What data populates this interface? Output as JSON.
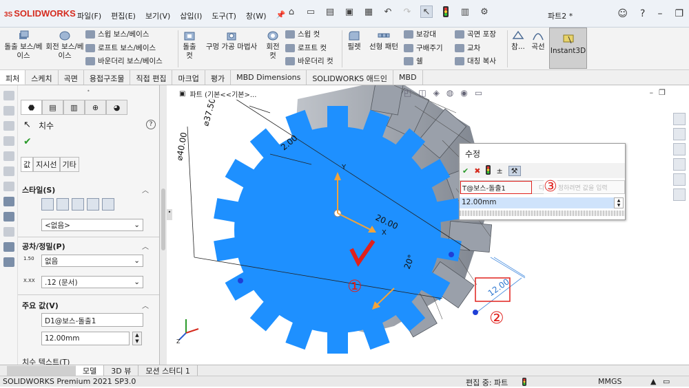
{
  "app": {
    "brand": "SOLIDWORKS",
    "part_name": "파트2 *"
  },
  "menu": [
    "파일(F)",
    "편집(E)",
    "보기(V)",
    "삽입(I)",
    "도구(T)",
    "창(W)"
  ],
  "ribbon": {
    "extrude_boss": "돌출 보스/베이스",
    "revolve_boss": "회전 보스/베이스",
    "sweep_boss": "스윕 보스/베이스",
    "loft_boss": "로프트 보스/베이스",
    "boundary_boss": "바운더리 보스/베이스",
    "extrude_cut": "돌출 컷",
    "hole_wizard": "구멍 가공 마법사",
    "revolve_cut": "회전 컷",
    "sweep_cut": "스윕 컷",
    "loft_cut": "로프트 컷",
    "boundary_cut": "바운더리 컷",
    "fillet": "필렛",
    "linear_pattern": "선형 패턴",
    "rib": "보강대",
    "draft": "구배주기",
    "shell": "쉘",
    "wrap": "곡면 포장",
    "intersect": "교차",
    "mirror": "대칭 복사",
    "reference": "참...",
    "curves": "곡선",
    "instant3d": "Instant3D"
  },
  "tabs": [
    "피처",
    "스케치",
    "곡면",
    "용접구조물",
    "직접 편집",
    "마크업",
    "평가",
    "MBD Dimensions",
    "SOLIDWORKS 애드인",
    "MBD"
  ],
  "propertymanager": {
    "title": "치수",
    "help": "?",
    "subtabs": [
      "값",
      "지시선",
      "기타"
    ],
    "style_header": "스타일(S)",
    "style_value": "<없음>",
    "tolerance_header": "공차/정밀(P)",
    "tolerance_type": "없음",
    "precision": ".12 (문서)",
    "tol_icon_text": "1.50",
    "prec_icon_text": "X.XX",
    "primary_header": "주요 값(V)",
    "primary_name": "D1@보스-돌출1",
    "primary_value": "12.00mm",
    "dim_text_header": "치수 텍스트(T)"
  },
  "graphics": {
    "breadcrumb": "파트 (기본<<기본>...",
    "dims": {
      "d40": "⌀40.00",
      "d37": "⌀37.50",
      "d2": "2.00",
      "d20": "20.00",
      "d20deg": "20°",
      "d12": "12.00"
    },
    "axes": {
      "x": "X",
      "y": "Y",
      "z": "Z"
    },
    "markers": [
      "①",
      "②",
      "③"
    ]
  },
  "modify": {
    "title": "수정",
    "name_field": "T@보스-돌출1",
    "hint": "다시 수정하려면 값을 입력",
    "value": "12.00mm"
  },
  "bottom_tabs": [
    "모델",
    "3D 뷰",
    "모션 스터디 1"
  ],
  "status": {
    "left": "SOLIDWORKS Premium 2021 SP3.0",
    "editing": "편집 중: 파트",
    "units": "MMGS"
  },
  "colors": {
    "gear_face": "#1e90ff",
    "gear_side": "#9aa0aa",
    "accent_red": "#e0201c",
    "dim_blue": "#2f78d0",
    "ribbon": "#f3f3f3"
  }
}
